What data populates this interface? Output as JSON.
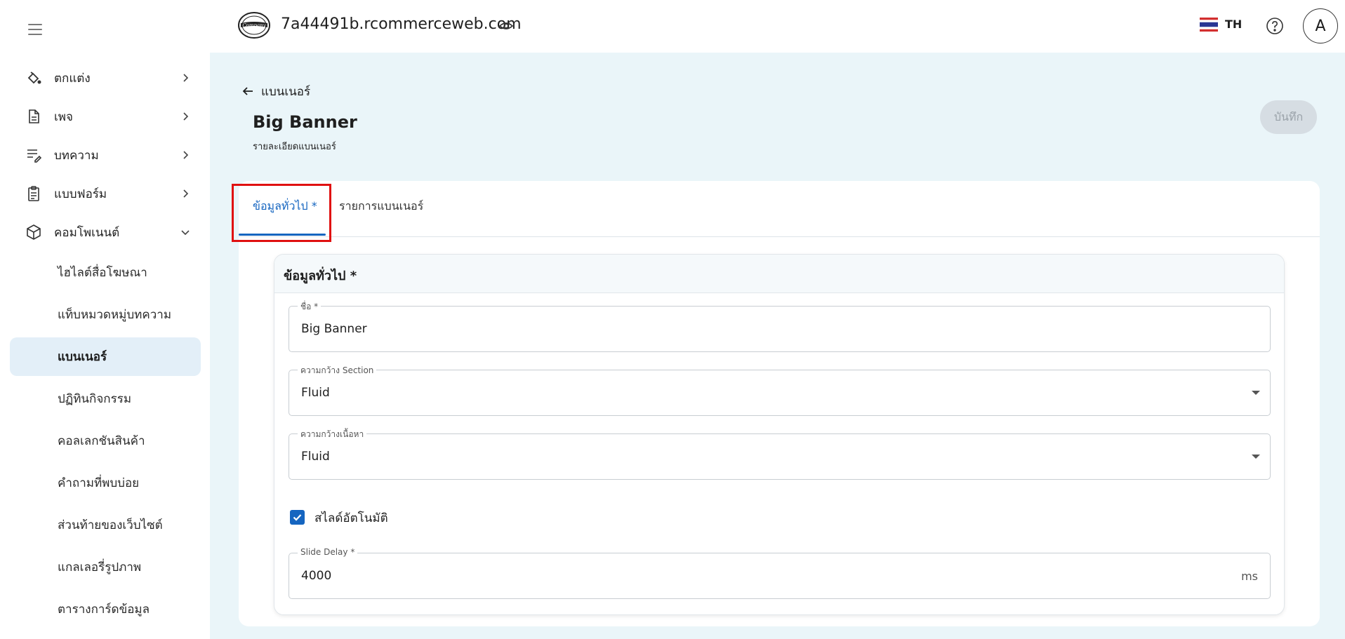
{
  "sidebar": {
    "menu": [
      {
        "label": "ตกแต่ง",
        "icon": "paint-bucket-icon"
      },
      {
        "label": "เพจ",
        "icon": "page-icon"
      },
      {
        "label": "บทความ",
        "icon": "article-edit-icon"
      },
      {
        "label": "แบบฟอร์ม",
        "icon": "form-clipboard-icon"
      },
      {
        "label": "คอมโพเนนต์",
        "icon": "component-cube-icon"
      }
    ],
    "sub_items": [
      {
        "label": "ไฮไลต์สื่อโฆษณา"
      },
      {
        "label": "แท็บหมวดหมู่บทความ"
      },
      {
        "label": "แบนเนอร์",
        "active": true
      },
      {
        "label": "ปฏิทินกิจกรรม"
      },
      {
        "label": "คอลเลกชันสินค้า"
      },
      {
        "label": "คำถามที่พบบ่อย"
      },
      {
        "label": "ส่วนท้ายของเว็บไซต์"
      },
      {
        "label": "แกลเลอรี่รูปภาพ"
      },
      {
        "label": "ตารางการ์ดข้อมูล"
      }
    ]
  },
  "header": {
    "domain": "7a44491b.rcommerceweb.com",
    "language": "TH",
    "avatar_initial": "A"
  },
  "page": {
    "back_label": "แบนเนอร์",
    "title": "Big Banner",
    "subtitle": "รายละเอียดแบนเนอร์",
    "save_label": "บันทึก"
  },
  "tabs": [
    {
      "label": "ข้อมูลทั่วไป *",
      "active": true
    },
    {
      "label": "รายการแบนเนอร์",
      "active": false
    }
  ],
  "section": {
    "title": "ข้อมูลทั่วไป *",
    "name_field": {
      "label": "ชื่อ *",
      "value": "Big Banner"
    },
    "section_width": {
      "label": "ความกว้าง Section",
      "value": "Fluid"
    },
    "content_width": {
      "label": "ความกว้างเนื้อหา",
      "value": "Fluid"
    },
    "autoslide": {
      "label": "สไลด์อัตโนมัติ",
      "checked": true
    },
    "slide_delay": {
      "label": "Slide Delay *",
      "value": "4000",
      "unit": "ms"
    }
  },
  "colors": {
    "accent": "#1565c0",
    "highlight": "#e01010",
    "background": "#eaf5f9"
  }
}
